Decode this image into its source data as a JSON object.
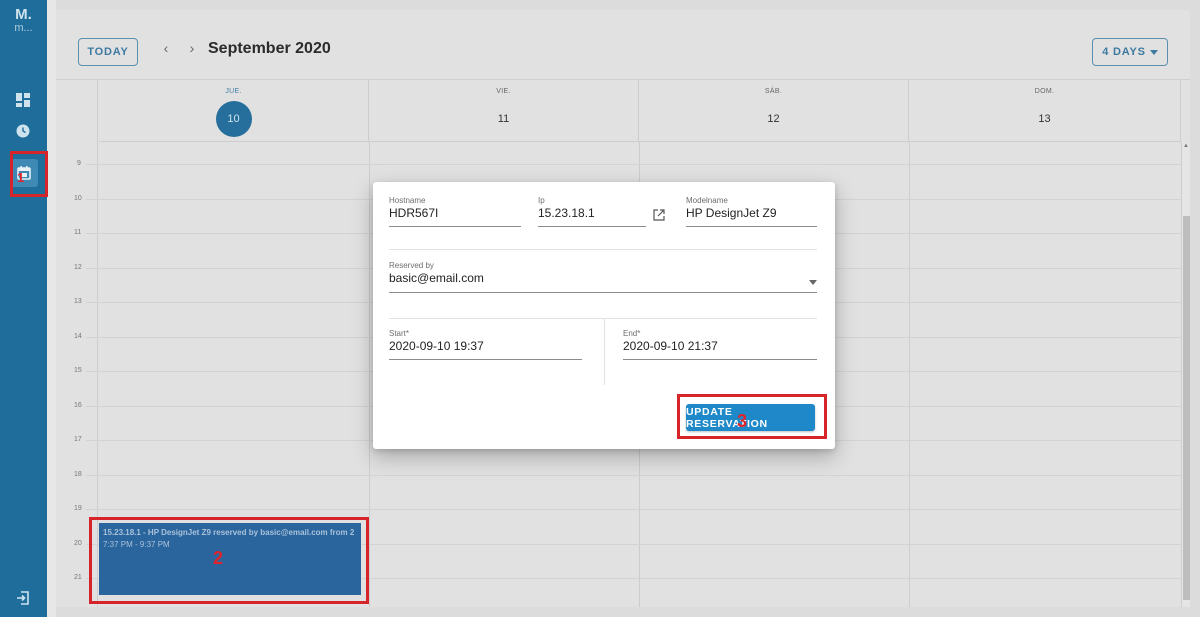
{
  "rail": {
    "logo_line1": "M.",
    "logo_line2": "m...",
    "items": [
      "dashboard-icon",
      "clock-icon",
      "calendar-icon"
    ],
    "bottom_item": "logout-icon"
  },
  "toolbar": {
    "today_label": "TODAY",
    "prev_label": "‹",
    "next_label": "›",
    "month_title": "September 2020",
    "view_label": "4 DAYS"
  },
  "days": [
    {
      "weekday": "JUE.",
      "date": "10",
      "today": true
    },
    {
      "weekday": "VIE.",
      "date": "11",
      "today": false
    },
    {
      "weekday": "SÁB.",
      "date": "12",
      "today": false
    },
    {
      "weekday": "DOM.",
      "date": "13",
      "today": false
    }
  ],
  "hours": [
    "9",
    "10",
    "11",
    "12",
    "13",
    "14",
    "15",
    "16",
    "17",
    "18",
    "19",
    "20",
    "21"
  ],
  "event": {
    "title": "15.23.18.1 - HP DesignJet Z9 reserved by basic@email.com from 2",
    "time": "7:37 PM - 9:37 PM"
  },
  "dialog": {
    "hostname_label": "Hostname",
    "hostname_value": "HDR567I",
    "ip_label": "Ip",
    "ip_value": "15.23.18.1",
    "modelname_label": "Modelname",
    "modelname_value": "HP DesignJet Z9",
    "reserved_by_label": "Reserved by",
    "reserved_by_value": "basic@email.com",
    "start_label": "Start*",
    "start_value": "2020-09-10 19:37",
    "end_label": "End*",
    "end_value": "2020-09-10 21:37",
    "update_label": "UPDATE RESERVATION"
  },
  "callouts": {
    "one": "1",
    "two": "2",
    "three": "3"
  },
  "colors": {
    "accent": "#1f88c9",
    "rail": "#1e6d9b",
    "event": "#2b659e",
    "callout": "#d5242a"
  }
}
